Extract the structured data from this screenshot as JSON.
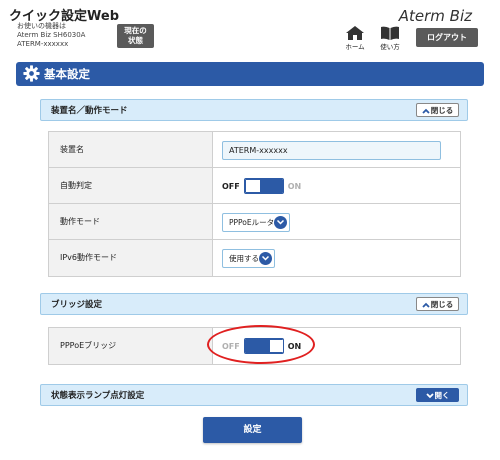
{
  "header": {
    "app_title": "クイック設定Web",
    "device_info": {
      "line1": "お使いの機器は",
      "line2": "Aterm Biz SH6030A",
      "line3": "ATERM-xxxxxx"
    },
    "status_button": {
      "line1": "現在の",
      "line2": "状態"
    },
    "brand": "Aterm Biz",
    "nav": {
      "home_label": "ホーム",
      "help_label": "使い方"
    },
    "logout_label": "ログアウト"
  },
  "page": {
    "title": "基本設定"
  },
  "sections": {
    "device": {
      "title": "装置名／動作モード",
      "toggle_label": "閉じる",
      "toggle_state": "expanded",
      "rows": {
        "device_name": {
          "label": "装置名",
          "value": "ATERM-xxxxxx"
        },
        "auto_detect": {
          "label": "自動判定",
          "off_label": "OFF",
          "on_label": "ON",
          "state": "off"
        },
        "mode": {
          "label": "動作モード",
          "selected": "PPPoEルータ"
        },
        "ipv6_mode": {
          "label": "IPv6動作モード",
          "selected": "使用する"
        }
      }
    },
    "bridge": {
      "title": "ブリッジ設定",
      "toggle_label": "閉じる",
      "toggle_state": "expanded",
      "rows": {
        "pppoe_bridge": {
          "label": "PPPoEブリッジ",
          "off_label": "OFF",
          "on_label": "ON",
          "state": "on"
        }
      }
    },
    "lamp": {
      "title": "状態表示ランプ点灯設定",
      "toggle_label": "開く",
      "toggle_state": "collapsed"
    }
  },
  "actions": {
    "submit_label": "設定"
  },
  "colors": {
    "primary": "#2c5aa6",
    "section_bg": "#d8ecfa",
    "highlight": "#e02020",
    "dark_button": "#5a5a5a"
  }
}
